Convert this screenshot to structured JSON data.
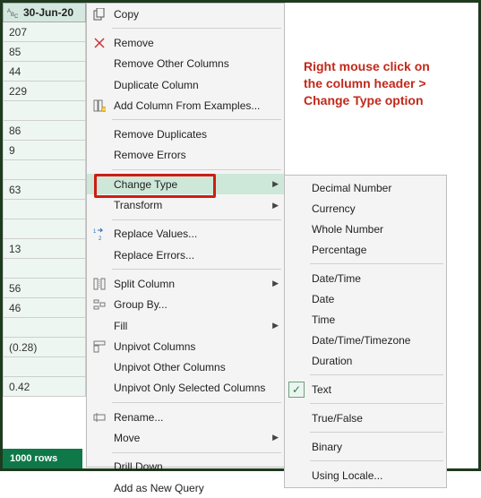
{
  "column": {
    "type_label": "ABC",
    "header": "30-Jun-20",
    "cells": [
      "207",
      "85",
      "44",
      "229",
      "",
      "86",
      "9",
      "",
      "63",
      "",
      "",
      "13",
      "",
      "56",
      "46",
      "",
      "(0.28)",
      "",
      "0.42"
    ]
  },
  "footer": {
    "rows_text": "1000 rows"
  },
  "annotation": {
    "line1": "Right mouse click on",
    "line2": "the column header >",
    "line3": "Change Type option"
  },
  "menu": {
    "copy": "Copy",
    "remove": "Remove",
    "remove_other": "Remove Other Columns",
    "duplicate": "Duplicate Column",
    "add_from_examples": "Add Column From Examples...",
    "remove_dups": "Remove Duplicates",
    "remove_errors": "Remove Errors",
    "change_type": "Change Type",
    "transform": "Transform",
    "replace_values": "Replace Values...",
    "replace_errors": "Replace Errors...",
    "split_column": "Split Column",
    "group_by": "Group By...",
    "fill": "Fill",
    "unpivot": "Unpivot Columns",
    "unpivot_other": "Unpivot Other Columns",
    "unpivot_selected": "Unpivot Only Selected Columns",
    "rename": "Rename...",
    "move": "Move",
    "drill_down": "Drill Down",
    "add_as_new_query": "Add as New Query"
  },
  "submenu": {
    "decimal": "Decimal Number",
    "currency": "Currency",
    "whole": "Whole Number",
    "percentage": "Percentage",
    "datetime": "Date/Time",
    "date": "Date",
    "time": "Time",
    "datetime_tz": "Date/Time/Timezone",
    "duration": "Duration",
    "text": "Text",
    "truefalse": "True/False",
    "binary": "Binary",
    "using_locale": "Using Locale..."
  }
}
